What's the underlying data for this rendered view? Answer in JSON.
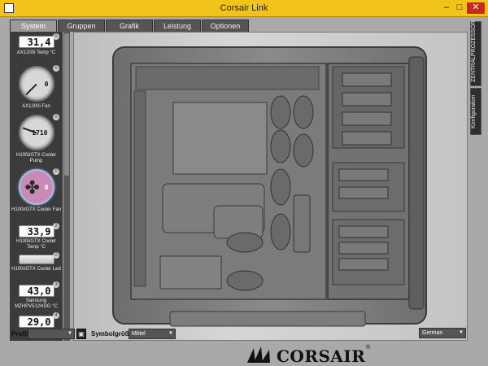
{
  "window": {
    "title": "Corsair Link"
  },
  "titlebar": {
    "minimize": "–",
    "maximize": "□",
    "close": "✕"
  },
  "tabs": [
    "System",
    "Gruppen",
    "Grafik",
    "Leistung",
    "Optionen"
  ],
  "sidebar": {
    "widgets": [
      {
        "type": "digital",
        "idx": "0",
        "value": "31,4",
        "label": "AX1200i Temp °C"
      },
      {
        "type": "gauge",
        "idx": "0",
        "value": "0",
        "label": "AX1200i Fan"
      },
      {
        "type": "gauge",
        "idx": "0",
        "value": "1710",
        "label": "H100i/GTX Cooler Pump"
      },
      {
        "type": "fan",
        "idx": "0",
        "value": "0",
        "label": "H100i/GTX Cooler Fan"
      },
      {
        "type": "digital",
        "idx": "2",
        "value": "33,9",
        "label": "H100i/GTX Cooler Temp",
        "unit": "°C"
      },
      {
        "type": "led",
        "idx": "0",
        "label": "H100i/GTX Cooler Led"
      },
      {
        "type": "digital",
        "idx": "3",
        "value": "43,0",
        "label": "Samsung MZHPV512HDG",
        "unit": "°C"
      },
      {
        "type": "digital",
        "idx": "4",
        "value": "29,0",
        "label": ""
      }
    ]
  },
  "right_tabs": [
    "ZENTRALPROZESSOR",
    "Konfiguration"
  ],
  "bottom": {
    "profil_label": "Profil:",
    "profil_value": "",
    "symbol_label": "Symbolgröße:",
    "symbol_value": "Mittel",
    "language_value": "German",
    "brand": "CORSAIR",
    "brand_reg": "®"
  },
  "colors": {
    "titlebar": "#f2c318",
    "close": "#c42b1c",
    "sidebar": "#3b3b3b",
    "fan_gauge": "#c98bb6"
  },
  "icons": {
    "fan_widget": "fan-icon",
    "save": "save-icon",
    "app": "app-icon"
  }
}
